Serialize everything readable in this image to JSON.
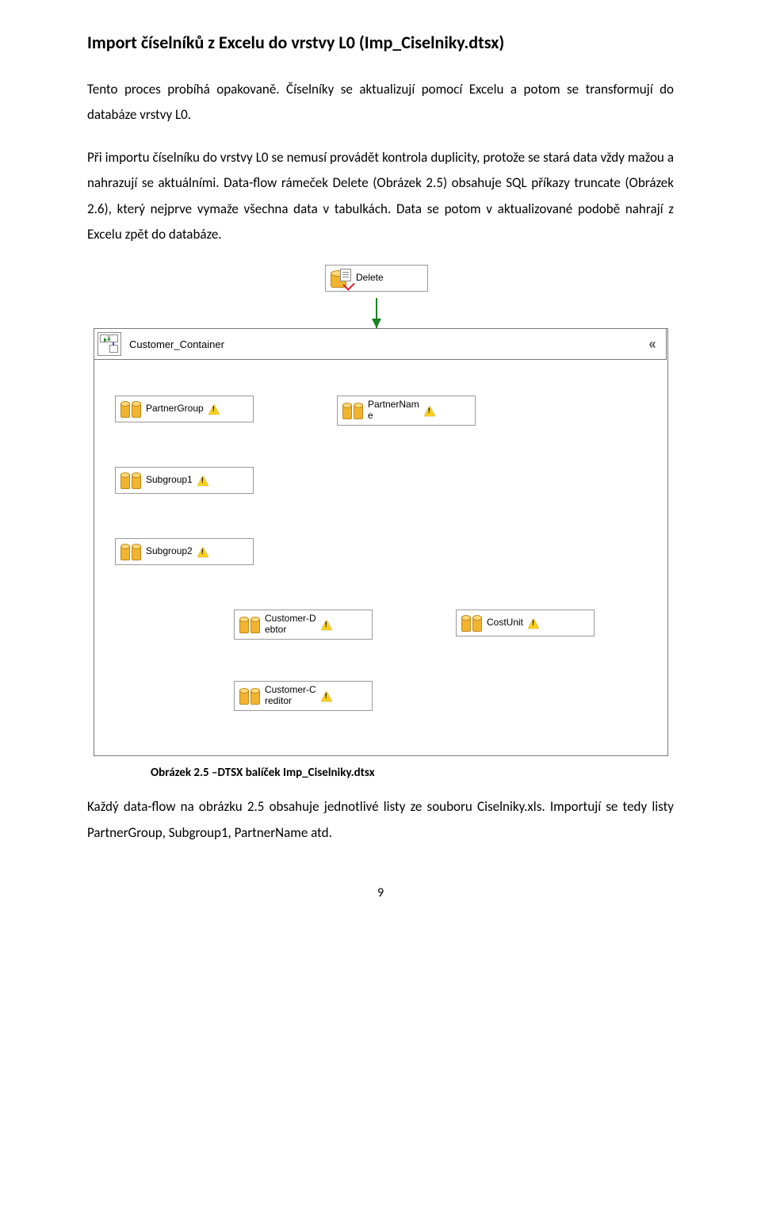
{
  "title": "Import číselníků z Excelu do vrstvy L0 (Imp_Ciselniky.dtsx)",
  "para1": "Tento proces probíhá opakovaně. Číselníky se aktualizují pomocí Excelu a potom se transformují do databáze vrstvy L0.",
  "para2": "Při importu číselníku do vrstvy L0 se nemusí provádět kontrola duplicity, protože se stará data vždy mažou a nahrazují se aktuálními. Data-flow rámeček Delete (Obrázek 2.5) obsahuje SQL příkazy truncate (Obrázek 2.6), který nejprve vymaže všechna data v tabulkách. Data se potom v aktualizované podobě nahrají z Excelu zpět do databáze.",
  "diagram": {
    "delete_label": "Delete",
    "container_label": "Customer_Container",
    "tasks": {
      "partnergroup": "PartnerGroup",
      "partnername": "PartnerNam\ne",
      "subgroup1": "Subgroup1",
      "subgroup2": "Subgroup2",
      "custdebtor": "Customer-D\nebtor",
      "costunit": "CostUnit",
      "custcreditor": "Customer-C\nreditor"
    }
  },
  "caption": "Obrázek 2.5 –DTSX balíček Imp_Ciselniky.dtsx",
  "para3": "Každý data-flow na obrázku 2.5 obsahuje jednotlivé listy ze souboru Ciselniky.xls. Importují se tedy listy PartnerGroup, Subgroup1, PartnerName atd.",
  "page_number": "9"
}
